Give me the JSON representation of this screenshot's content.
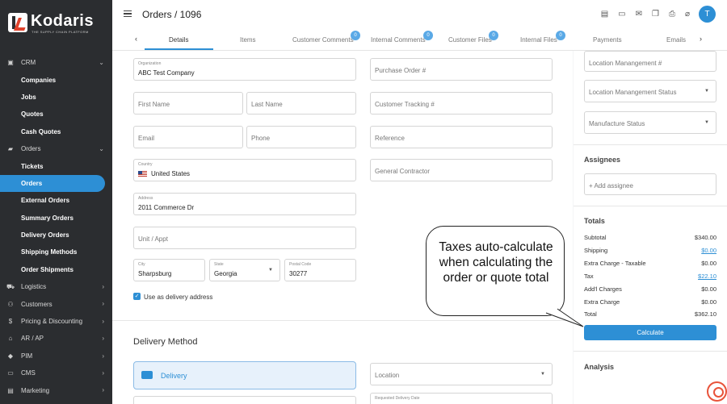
{
  "brand": {
    "name": "Kodaris",
    "tagline": "THE SUPPLY CHAIN PLATFORM"
  },
  "header": {
    "title": "Orders / 1096",
    "avatar_letter": "T",
    "icons": [
      "receipt-icon",
      "card-icon",
      "mail-icon",
      "copy-icon",
      "download-doc-icon",
      "attachment-icon"
    ]
  },
  "sidebar": {
    "items": [
      {
        "label": "CRM",
        "icon": "crm-icon",
        "chevron": "⌄"
      },
      {
        "label": "Companies",
        "sub": true
      },
      {
        "label": "Jobs",
        "sub": true
      },
      {
        "label": "Quotes",
        "sub": true
      },
      {
        "label": "Cash Quotes",
        "sub": true
      },
      {
        "label": "Orders",
        "icon": "truck-icon",
        "chevron": "⌄"
      },
      {
        "label": "Tickets",
        "sub": true
      },
      {
        "label": "Orders",
        "sub": true,
        "active": true
      },
      {
        "label": "External Orders",
        "sub": true
      },
      {
        "label": "Summary Orders",
        "sub": true
      },
      {
        "label": "Delivery Orders",
        "sub": true
      },
      {
        "label": "Shipping Methods",
        "sub": true
      },
      {
        "label": "Order Shipments",
        "sub": true
      },
      {
        "label": "Logistics",
        "icon": "logistics-icon",
        "chevron": "›"
      },
      {
        "label": "Customers",
        "icon": "users-icon",
        "chevron": "›"
      },
      {
        "label": "Pricing & Discounting",
        "icon": "dollar-icon",
        "chevron": "›"
      },
      {
        "label": "AR / AP",
        "icon": "bank-icon",
        "chevron": "›"
      },
      {
        "label": "PIM",
        "icon": "tag-icon",
        "chevron": "›"
      },
      {
        "label": "CMS",
        "icon": "cms-icon",
        "chevron": "›"
      },
      {
        "label": "Marketing",
        "icon": "marketing-icon",
        "chevron": "›"
      }
    ]
  },
  "tabs": [
    {
      "label": "Details",
      "active": true
    },
    {
      "label": "Items"
    },
    {
      "label": "Customer Comments",
      "badge": "0"
    },
    {
      "label": "Internal Comments",
      "badge": "0"
    },
    {
      "label": "Customer Files",
      "badge": "0"
    },
    {
      "label": "Internal Files",
      "badge": "0"
    },
    {
      "label": "Payments"
    },
    {
      "label": "Emails"
    }
  ],
  "form": {
    "organization": {
      "label": "Organization",
      "value": "ABC Test Company"
    },
    "purchase_order": {
      "placeholder": "Purchase Order #"
    },
    "first_name": {
      "placeholder": "First Name"
    },
    "last_name": {
      "placeholder": "Last Name"
    },
    "customer_tracking": {
      "placeholder": "Customer Tracking #"
    },
    "email": {
      "placeholder": "Email"
    },
    "phone": {
      "placeholder": "Phone"
    },
    "reference": {
      "placeholder": "Reference"
    },
    "country": {
      "label": "Country",
      "value": "United States"
    },
    "general_contractor": {
      "placeholder": "General Contractor"
    },
    "address": {
      "label": "Address",
      "value": "2011 Commerce Dr"
    },
    "unit": {
      "placeholder": "Unit / Appt"
    },
    "city": {
      "label": "City",
      "value": "Sharpsburg"
    },
    "state": {
      "label": "State",
      "value": "Georgia"
    },
    "postal": {
      "label": "Postal Code",
      "value": "30277"
    },
    "delivery_checkbox": "Use as delivery address",
    "delivery_method_title": "Delivery Method",
    "delivery_button": "Delivery",
    "location": {
      "placeholder": "Location"
    },
    "requested_date": {
      "label": "Requested Delivery Date"
    }
  },
  "right_panel": {
    "location_mgmt": "Location Manangement #",
    "location_mgmt_status": "Location Manangement Status",
    "manufacture_status": "Manufacture Status",
    "assignees_title": "Assignees",
    "add_assignee": "+ Add assignee",
    "totals_title": "Totals",
    "totals": [
      {
        "label": "Subtotal",
        "value": "$340.00",
        "link": false
      },
      {
        "label": "Shipping",
        "value": "$0.00",
        "link": true
      },
      {
        "label": "Extra Charge - Taxable",
        "value": "$0.00",
        "link": false
      },
      {
        "label": "Tax",
        "value": "$22.10",
        "link": true
      },
      {
        "label": "Add'l Charges",
        "value": "$0.00",
        "link": false
      },
      {
        "label": "Extra Charge",
        "value": "$0.00",
        "link": false
      },
      {
        "label": "Total",
        "value": "$362.10",
        "link": false
      }
    ],
    "calculate_button": "Calculate",
    "analysis_title": "Analysis"
  },
  "callout": {
    "text": "Taxes auto-calculate when calculating the order or quote total"
  }
}
